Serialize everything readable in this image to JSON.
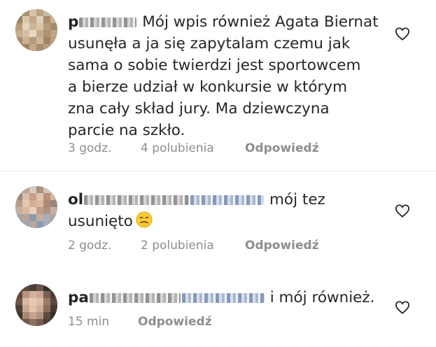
{
  "comments": [
    {
      "username_visible": "p",
      "text_lines": [
        "Mój wpis również Agata Biernat",
        "usunęła a ja się zapytalam czemu jak",
        "sama o sobie twierdzi jest sportowcem",
        "a bierze udział w konkursie w którym",
        "zna cały skład jury. Ma dziewczyna",
        "parcie na szkło."
      ],
      "time": "3 godz.",
      "likes": "4 polubienia",
      "reply": "Odpowiedź"
    },
    {
      "username_visible": "ol",
      "text_lines": [
        "mój tez",
        "usunięto"
      ],
      "emoji": "smirk-emoji",
      "time": "2 godz.",
      "likes": "2 polubienia",
      "reply": "Odpowiedź"
    },
    {
      "username_visible": "pa",
      "text_lines": [
        "i mój również."
      ],
      "time": "15 min",
      "reply": "Odpowiedź"
    }
  ],
  "icons": {
    "like": "heart-outline-icon"
  },
  "colors": {
    "text": "#262626",
    "meta": "#8e8e8e",
    "divider": "#e6e6e6"
  }
}
